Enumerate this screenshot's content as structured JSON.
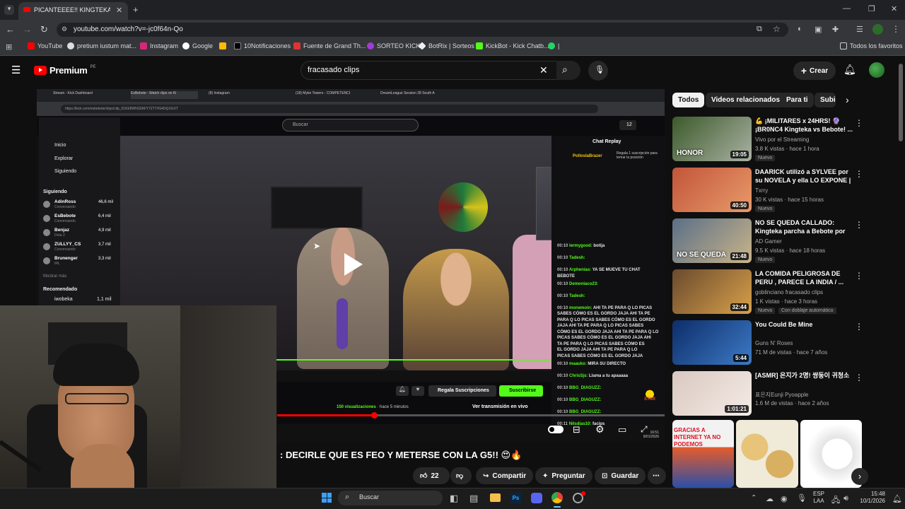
{
  "browser": {
    "tab_title": "PICANTEEEE!! KINGTEKA",
    "url": "youtube.com/watch?v=-jc0f64n-Qo",
    "bookmarks": [
      "YouTube",
      "pretium iustum mat...",
      "Instagram",
      "Google",
      "",
      "10Notificaciones",
      "Fuente de Grand Th...",
      "SORTEO KICK",
      "BotRix | Sorteos",
      "KickBot - Kick Chatb...",
      "|"
    ],
    "all_favorites": "Todos los favoritos"
  },
  "youtube": {
    "logo": "Premium",
    "logo_sup": "PE",
    "search_value": "fracasado clips",
    "create_label": "Crear"
  },
  "inner_browser": {
    "tabs": [
      "Stream - Kick Dashboard",
      "EsBebote - Watch clips on Ki",
      "(8) Instagram",
      "(18) Myke Towers - COMPETENCI",
      "DreamLeague Session 28 South A"
    ],
    "url": "https://kick.com/esbebote/clips/clip_01KE8WN32AFY7ZTT4S4DQXGXT"
  },
  "kick": {
    "search_placeholder": "Buscar",
    "nav": [
      "Inicio",
      "Explorar",
      "Siguiendo"
    ],
    "following_header": "Siguiendo",
    "following": [
      {
        "name": "AdinRoss",
        "sub": "Conversando",
        "count": "46,6 mil"
      },
      {
        "name": "EsBebote",
        "sub": "Conversando",
        "count": "6,4 mil"
      },
      {
        "name": "Benjaz",
        "sub": "Dota 2",
        "count": "4,9 mil"
      },
      {
        "name": "ZULLYY_CS",
        "sub": "Conversando",
        "count": "3,7 mil"
      },
      {
        "name": "Brunenger",
        "sub": "IRL",
        "count": "3,3 mil"
      }
    ],
    "show_more": "Mostrar más",
    "recommended_header": "Recomendado",
    "recommended": {
      "name": "iwobeka",
      "count": "1,1 mil"
    },
    "viewer_badge": "12",
    "chat_title": "Chat Replay",
    "gift_user": "PollosIaBrazer",
    "gift_text": "Regala 1 suscripción para tomar la posición",
    "chat": [
      {
        "t": "00:10",
        "u": "lermygood:",
        "m": "botija"
      },
      {
        "t": "00:10",
        "u": "Tadesh:",
        "m": ""
      },
      {
        "t": "00:10",
        "u": "Arphenias:",
        "m": "YA SE MUEVE TU CHAT"
      },
      {
        "t": "",
        "u": "",
        "m": "BEBOTE"
      },
      {
        "t": "00:10",
        "u": "Demoniaco23:",
        "m": ""
      },
      {
        "t": "00:10",
        "u": "Tadesh:",
        "m": ""
      },
      {
        "t": "00:10",
        "u": "monemoin:",
        "m": "AHI TA PE PARA Q LO PICAS"
      },
      {
        "t": "",
        "u": "",
        "m": "SABES CÓMO ES EL GORDO JAJA AHI TA PE"
      },
      {
        "t": "",
        "u": "",
        "m": "PARA Q LO PICAS SABES CÓMO ES EL GORDO"
      },
      {
        "t": "",
        "u": "",
        "m": "JAJA AHI TA PE PARA Q LO PICAS SABES"
      },
      {
        "t": "",
        "u": "",
        "m": "CÓMO ES EL GORDO JAJA AHI TA PE PARA Q LO"
      },
      {
        "t": "",
        "u": "",
        "m": "PICAS SABES CÓMO ES EL GORDO JAJA AHI"
      },
      {
        "t": "",
        "u": "",
        "m": "TA PE PARA Q LO PICAS SABES CÓMO ES"
      },
      {
        "t": "",
        "u": "",
        "m": "EL GORDO JAJA AHI TA PE PARA Q LO"
      },
      {
        "t": "",
        "u": "",
        "m": "PICAS SABES CÓMO ES EL GORDO JAJA"
      },
      {
        "t": "00:10",
        "u": "maauko:",
        "m": "MIRA SU DIRECTO"
      },
      {
        "t": "00:10",
        "u": "ChrisSjs:",
        "m": "Llama a tu apaaaaa"
      },
      {
        "t": "00:10",
        "u": "BBG_DIAGUZZ:",
        "m": ""
      },
      {
        "t": "00:10",
        "u": "BBG_DIAGUZZ:",
        "m": ""
      },
      {
        "t": "00:10",
        "u": "BBG_DIAGUZZ:",
        "m": ""
      },
      {
        "t": "00:11",
        "u": "Nilsdias10:",
        "m": "facips"
      }
    ],
    "gift_btn": "Regala Suscripciones",
    "subscribe_btn": "Suscribirse",
    "views": "150 visualizaciones",
    "ago": "hace 5 minutos",
    "watch_live": "Ver transmisión en vivo",
    "star_badge": "STAR",
    "progress": 0.25
  },
  "video": {
    "title": ": DECIRLE QUE ES FEO Y METERSE CON LA G5!! 😍🔥",
    "likes": "22",
    "share": "Compartir",
    "ask": "Preguntar",
    "save": "Guardar",
    "corner_time": "16:51",
    "corner_date": "9/01/2026"
  },
  "chips": [
    "Todos",
    "Videos relacionados",
    "Para ti",
    "Subid"
  ],
  "recommendations": [
    {
      "title": "💪 ¡MILITARES x 24HRS! 🔮 ¡BR0NC4 Kingteka vs Bebote! ...",
      "channel": "Vivo por el Streaming",
      "meta": "3.8 K vistas · hace 1 hora",
      "badge": "Nuevo",
      "badge2": "",
      "duration": "19:05",
      "thumb_text": "HONOR",
      "c1": "#3c5a2a",
      "c2": "#a9b1a3"
    },
    {
      "title": "DAARICK utilizó a SYLVEE por su NOVELA y ella LO EXPONE | ...",
      "channel": "Txrry",
      "meta": "30 K vistas · hace 15 horas",
      "badge": "Nuevo",
      "badge2": "",
      "duration": "40:50",
      "thumb_text": "",
      "c1": "#c2553a",
      "c2": "#e89a6a"
    },
    {
      "title": "NO SE QUEDA CALLADO: Kingteka parcha a Bebote por l...",
      "channel": "AD Gamer",
      "meta": "9.5 K vistas · hace 18 horas",
      "badge": "Nuevo",
      "badge2": "",
      "duration": "21:48",
      "thumb_text": "NO SE QUEDA",
      "c1": "#5b6f86",
      "c2": "#c9b48a"
    },
    {
      "title": "LA COMIDA PELIGROSA DE PERU , PARECE LA INDIA / ...",
      "channel": "goblinciano fracasado clips",
      "meta": "1 K vistas · hace 3 horas",
      "badge": "Nuevo",
      "badge2": "Con doblaje automático",
      "duration": "32:44",
      "thumb_text": "",
      "c1": "#6a4a2e",
      "c2": "#d8a04a"
    },
    {
      "title": "You Could Be Mine",
      "channel": "Guns N' Roses",
      "meta": "71 M de vistas · hace 7 años",
      "badge": "",
      "badge2": "",
      "duration": "5:44",
      "thumb_text": "",
      "c1": "#0d2d6a",
      "c2": "#3d7ac5"
    },
    {
      "title": "[ASMR] 은지가 2명! 쌍둥이 귀청소",
      "channel": "표은지Eunji Pyoapple",
      "meta": "1.6 M de vistas · hace 2 años",
      "badge": "",
      "badge2": "",
      "duration": "1:01:21",
      "thumb_text": "",
      "c1": "#d9c8c0",
      "c2": "#f4ece6"
    }
  ],
  "shorts_text": "GRACIAS A INTERNET YA NO PODEMOS",
  "taskbar": {
    "search": "Buscar",
    "lang1": "ESP",
    "lang2": "LAA",
    "time": "15:48",
    "date": "10/1/2026"
  }
}
